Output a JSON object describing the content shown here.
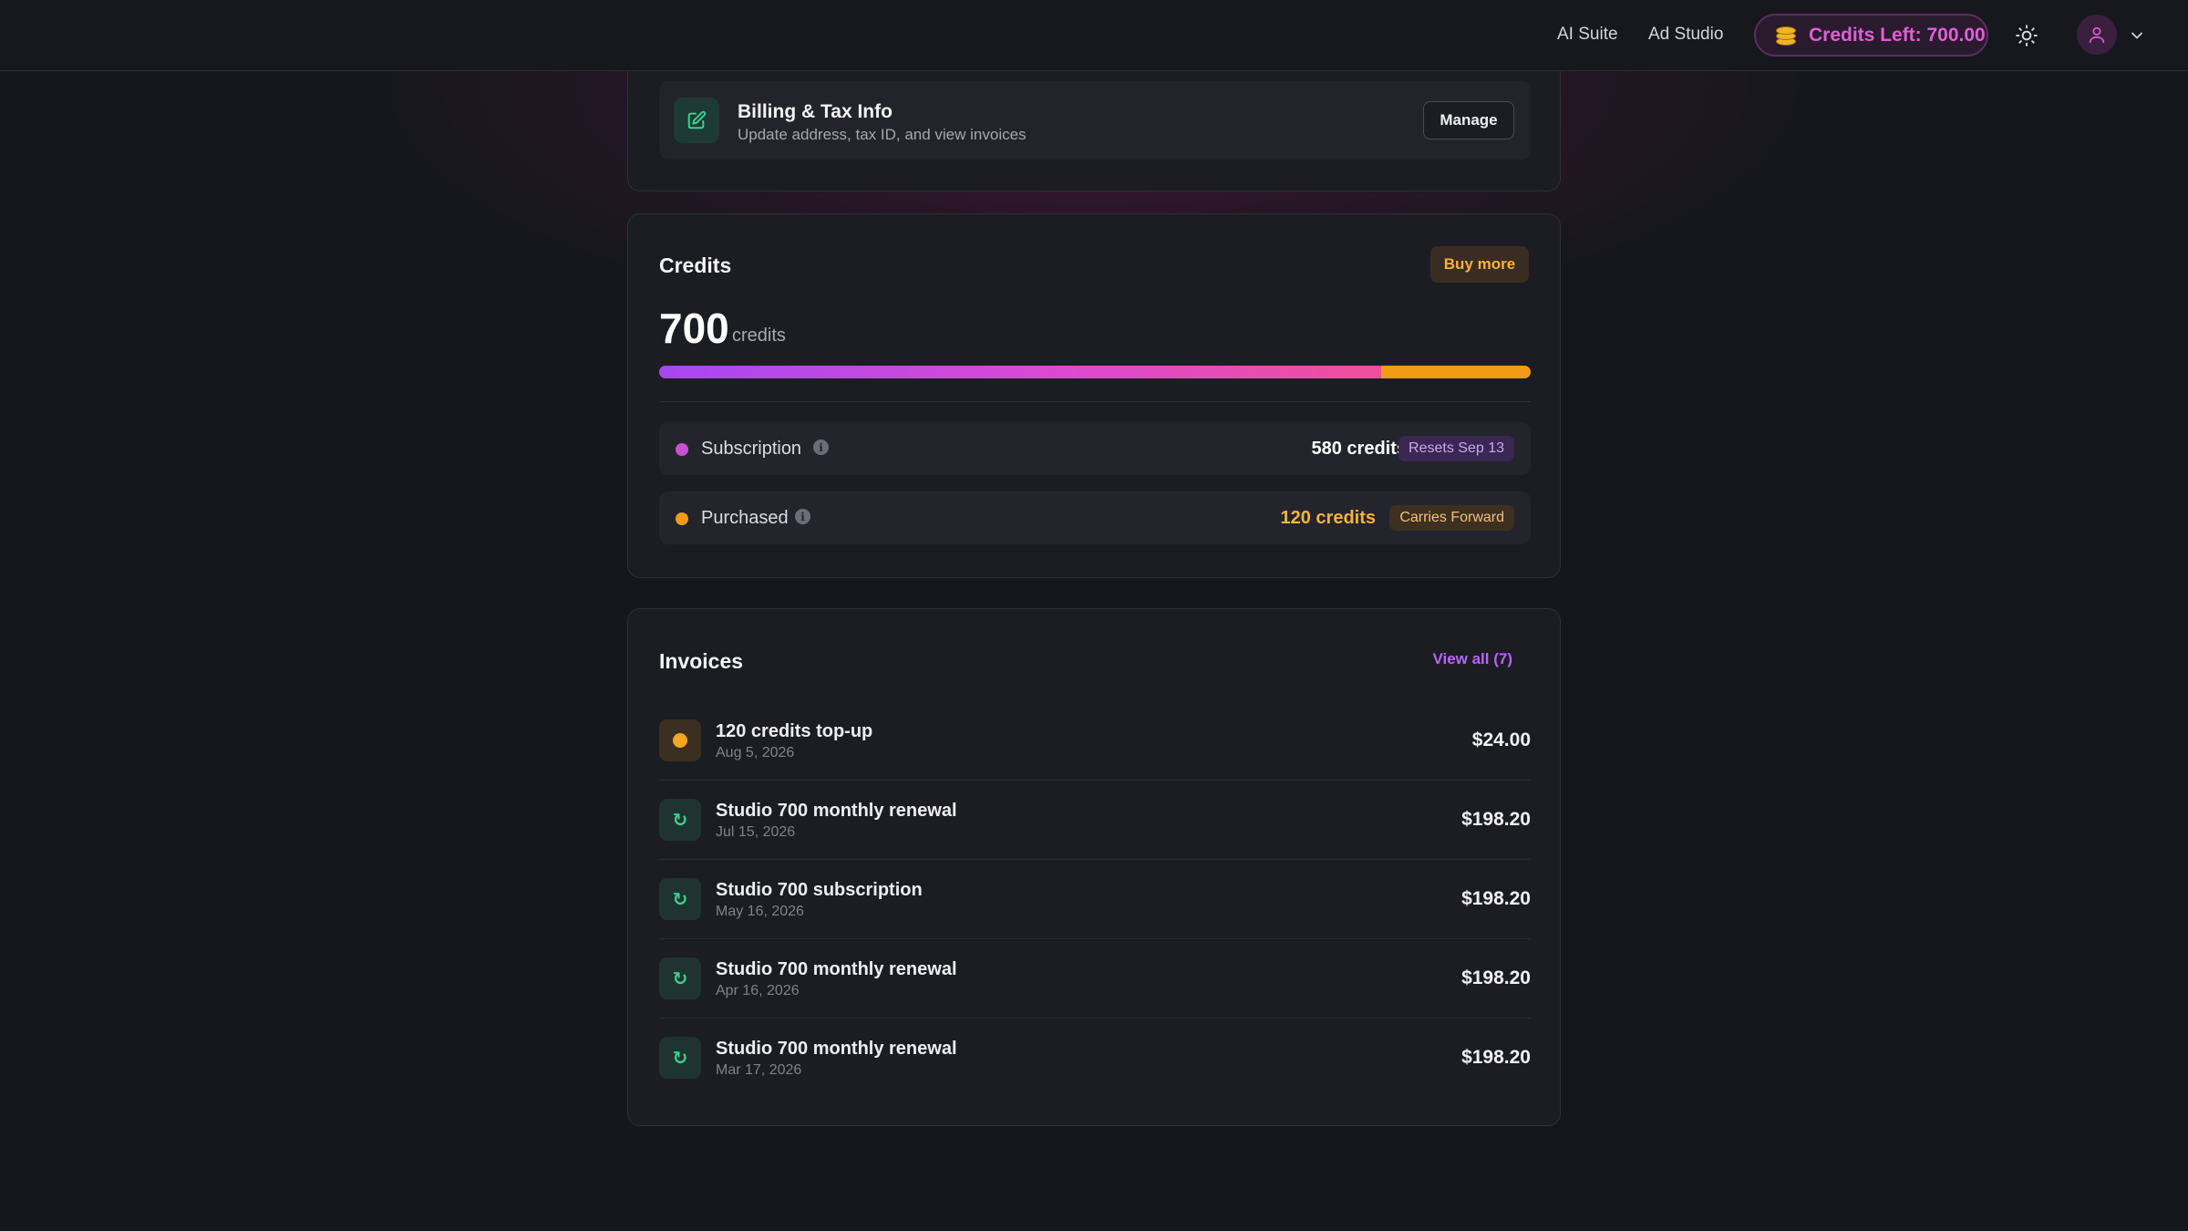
{
  "nav": {
    "links": [
      "AI Suite",
      "Ad Studio"
    ],
    "credits_pill": "Credits Left: 700.00"
  },
  "billing": {
    "title": "Billing & Tax Info",
    "subtitle": "Update address, tax ID, and view invoices",
    "manage_label": "Manage"
  },
  "credits": {
    "title": "Credits",
    "buy_label": "Buy more",
    "total": "700",
    "unit": "credits",
    "progress": {
      "subscription_fraction": 0.8286,
      "purchased_fraction": 0.1714
    },
    "rows": [
      {
        "label": "Subscription",
        "amount": "580 credits",
        "badge": "Resets Sep 13",
        "dot_color": "#c94fd3",
        "amount_color": "#ffffff",
        "badge_bg": "#3a2752",
        "badge_color": "#c9a8f2"
      },
      {
        "label": "Purchased",
        "amount": "120 credits",
        "badge": "Carries Forward",
        "dot_color": "#f39a16",
        "amount_color": "#f5b33c",
        "badge_bg": "#3d3021",
        "badge_color": "#f2c27a"
      }
    ]
  },
  "invoices": {
    "title": "Invoices",
    "view_all": "View all (7)",
    "items": [
      {
        "title": "120 credits top-up",
        "date": "Aug 5, 2026",
        "amount": "$24.00",
        "icon": "coin-icon"
      },
      {
        "title": "Studio 700 monthly renewal",
        "date": "Jul 15, 2026",
        "amount": "$198.20",
        "icon": "renew-icon"
      },
      {
        "title": "Studio 700 subscription",
        "date": "May 16, 2026",
        "amount": "$198.20",
        "icon": "renew-icon"
      },
      {
        "title": "Studio 700 monthly renewal",
        "date": "Apr 16, 2026",
        "amount": "$198.20",
        "icon": "renew-icon"
      },
      {
        "title": "Studio 700 monthly renewal",
        "date": "Mar 17, 2026",
        "amount": "$198.20",
        "icon": "renew-icon"
      }
    ]
  },
  "colors": {
    "accent_pink": "#e05fd6",
    "accent_orange": "#f39a16",
    "accent_purple": "#b766f5",
    "success_green": "#3ccf8e"
  }
}
